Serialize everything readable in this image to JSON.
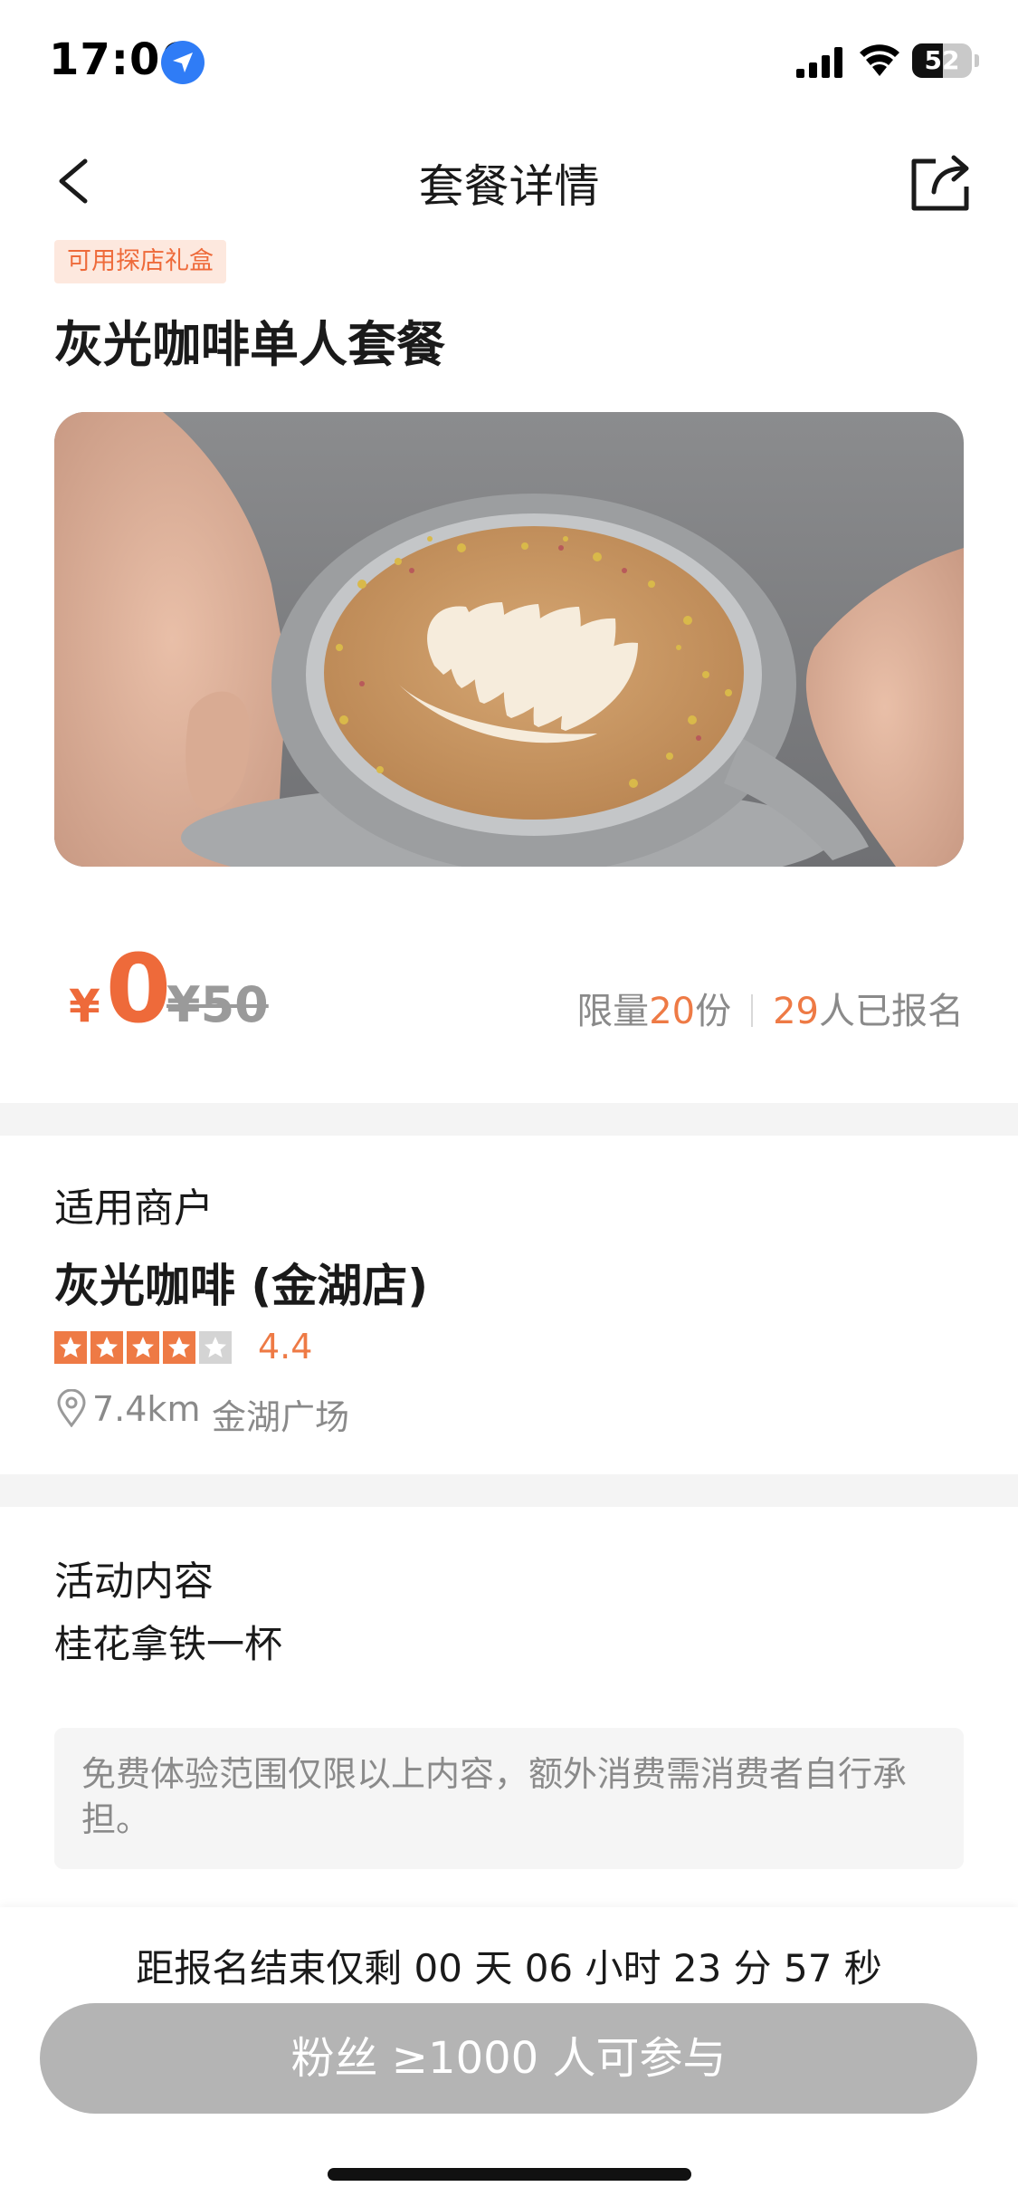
{
  "status_bar": {
    "time": "17:06",
    "battery": "52",
    "battery_level": 0.52
  },
  "nav": {
    "title": "套餐详情"
  },
  "header": {
    "tag": "可用探店礼盒",
    "title": "灰光咖啡单人套餐"
  },
  "price": {
    "currency": "¥",
    "current": "0",
    "original": "¥50",
    "limit_prefix": "限量",
    "limit_count": "20",
    "limit_unit": "份",
    "signup_count": "29",
    "signup_suffix": "人已报名"
  },
  "merchant": {
    "section_label": "适用商户",
    "name": "灰光咖啡 (金湖店)",
    "stars": 4,
    "rating": "4.4",
    "distance": "7.4km",
    "area": "金湖广场"
  },
  "activity": {
    "section_label": "活动内容",
    "content": "桂花拿铁一杯",
    "notice": "免费体验范围仅限以上内容，额外消费需消费者自行承担。"
  },
  "footer": {
    "countdown": "距报名结束仅剩 00 天 06 小时 23 分 57 秒",
    "button_label": "粉丝 ≥1000 人可参与"
  },
  "colors": {
    "accent": "#ee6a3a",
    "tag_bg": "#fde8de",
    "button_disabled": "#b4b4b4"
  },
  "icons": [
    "location-arrow-icon",
    "signal-icon",
    "wifi-icon",
    "battery-icon",
    "back-chevron-icon",
    "share-icon",
    "star-icon",
    "map-pin-icon"
  ]
}
